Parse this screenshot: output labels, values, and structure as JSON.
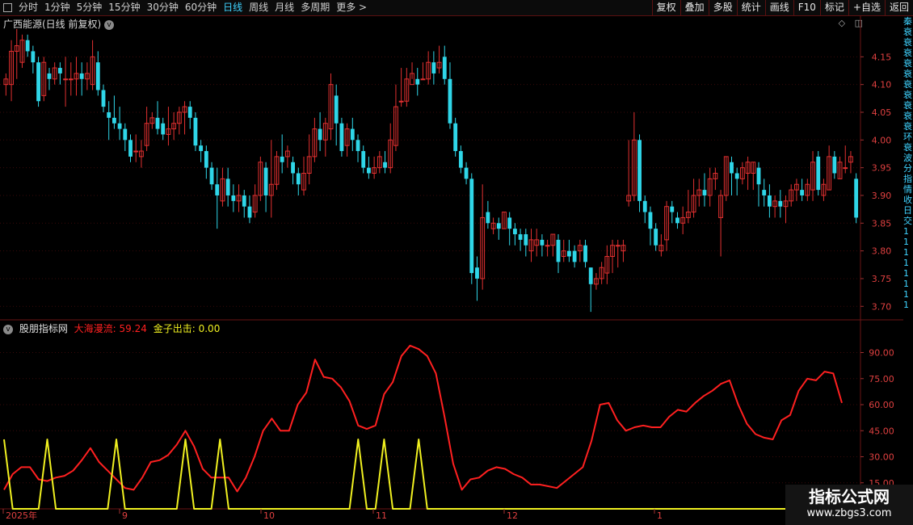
{
  "toolbar": {
    "left": [
      "分时",
      "1分钟",
      "5分钟",
      "15分钟",
      "30分钟",
      "60分钟",
      "日线",
      "周线",
      "月线",
      "多周期",
      "更多 >"
    ],
    "active": "日线",
    "right": [
      "复权",
      "叠加",
      "多股",
      "统计",
      "画线",
      "F10",
      "标记",
      "+自选",
      "返回"
    ]
  },
  "kpane": {
    "title": "广西能源(日线 前复权)",
    "ylabels": [
      "4.15",
      "4.10",
      "4.05",
      "4.00",
      "3.95",
      "3.90",
      "3.85",
      "3.80",
      "3.75",
      "3.70"
    ],
    "colors": {
      "up": "#e23030",
      "down": "#2fd6e8",
      "bg": "#000000",
      "grid": "#3a0a0a"
    }
  },
  "ipane": {
    "name": "股朋指标网",
    "series1_label": "大海漫流:",
    "series1_value": "59.24",
    "series2_label": "金子出击:",
    "series2_value": "0.00",
    "ylabels": [
      "90.00",
      "75.00",
      "60.00",
      "45.00",
      "30.00",
      "15.00"
    ],
    "colors": {
      "line1": "#ff2020",
      "line2": "#f0f020"
    }
  },
  "xaxis": {
    "labels": [
      "2025年",
      "9",
      "10",
      "11",
      "12",
      "1"
    ]
  },
  "watermark": {
    "title": "指标公式网",
    "url": "www.zbgs3.com"
  },
  "right_strip": [
    "秦",
    "衰",
    "衰",
    "衰",
    "衰",
    "衰",
    "衰",
    "衰",
    "衰",
    "衰",
    "衰",
    "环",
    "衰",
    "波",
    "分",
    "指",
    "情",
    "收",
    "",
    "",
    "日",
    "交",
    "1",
    "1",
    "1",
    "1",
    "1",
    "1",
    "1",
    "1"
  ],
  "chart_data": [
    {
      "type": "candlestick",
      "title": "广西能源(日线 前复权)",
      "ylim": [
        3.68,
        4.2
      ],
      "candles": [
        [
          4.1,
          4.11,
          4.08,
          4.12
        ],
        [
          4.1,
          4.16,
          4.07,
          4.18
        ],
        [
          4.16,
          4.17,
          4.11,
          4.2
        ],
        [
          4.14,
          4.18,
          4.13,
          4.19
        ],
        [
          4.18,
          4.16,
          4.15,
          4.19
        ],
        [
          4.16,
          4.14,
          4.12,
          4.17
        ],
        [
          4.14,
          4.07,
          4.06,
          4.15
        ],
        [
          4.08,
          4.14,
          4.07,
          4.15
        ],
        [
          4.12,
          4.11,
          4.09,
          4.13
        ],
        [
          4.11,
          4.13,
          4.1,
          4.14
        ],
        [
          4.13,
          4.12,
          4.1,
          4.14
        ],
        [
          4.11,
          4.11,
          4.06,
          4.15
        ],
        [
          4.11,
          4.11,
          4.08,
          4.14
        ],
        [
          4.11,
          4.12,
          4.08,
          4.15
        ],
        [
          4.12,
          4.11,
          4.08,
          4.14
        ],
        [
          4.11,
          4.12,
          4.09,
          4.14
        ],
        [
          4.1,
          4.15,
          4.09,
          4.18
        ],
        [
          4.14,
          4.09,
          4.08,
          4.16
        ],
        [
          4.09,
          4.06,
          4.05,
          4.1
        ],
        [
          4.05,
          4.04,
          4.0,
          4.07
        ],
        [
          4.04,
          4.03,
          4.02,
          4.08
        ],
        [
          4.03,
          4.02,
          4.0,
          4.06
        ],
        [
          4.02,
          4.0,
          3.98,
          4.03
        ],
        [
          4.0,
          3.97,
          3.96,
          4.01
        ],
        [
          3.98,
          3.98,
          3.96,
          4.01
        ],
        [
          3.97,
          3.98,
          3.95,
          4.0
        ],
        [
          3.99,
          4.03,
          3.98,
          4.06
        ],
        [
          4.03,
          4.04,
          4.02,
          4.05
        ],
        [
          4.04,
          4.02,
          4.01,
          4.07
        ],
        [
          4.03,
          4.01,
          4.0,
          4.04
        ],
        [
          4.01,
          4.02,
          3.99,
          4.06
        ],
        [
          4.02,
          4.03,
          4.0,
          4.05
        ],
        [
          4.03,
          4.05,
          4.01,
          4.06
        ],
        [
          4.05,
          4.06,
          4.01,
          4.07
        ],
        [
          4.06,
          4.04,
          4.02,
          4.07
        ],
        [
          4.04,
          3.99,
          3.98,
          4.05
        ],
        [
          3.99,
          3.98,
          3.96,
          4.0
        ],
        [
          3.98,
          3.95,
          3.93,
          3.99
        ],
        [
          3.95,
          3.92,
          3.91,
          3.96
        ],
        [
          3.92,
          3.9,
          3.84,
          3.95
        ],
        [
          3.89,
          3.93,
          3.88,
          3.95
        ],
        [
          3.93,
          3.9,
          3.88,
          3.95
        ],
        [
          3.9,
          3.89,
          3.87,
          3.92
        ],
        [
          3.89,
          3.9,
          3.87,
          3.92
        ],
        [
          3.9,
          3.88,
          3.86,
          3.91
        ],
        [
          3.88,
          3.86,
          3.85,
          3.9
        ],
        [
          3.87,
          3.9,
          3.86,
          3.92
        ],
        [
          3.9,
          3.96,
          3.89,
          3.97
        ],
        [
          3.95,
          3.9,
          3.87,
          3.96
        ],
        [
          3.9,
          3.92,
          3.86,
          4.0
        ],
        [
          3.92,
          3.97,
          3.91,
          3.98
        ],
        [
          3.97,
          3.96,
          3.94,
          4.01
        ],
        [
          3.97,
          3.98,
          3.95,
          3.99
        ],
        [
          3.96,
          3.94,
          3.92,
          3.97
        ],
        [
          3.94,
          3.92,
          3.9,
          3.95
        ],
        [
          3.91,
          3.94,
          3.9,
          3.97
        ],
        [
          3.94,
          3.97,
          3.92,
          4.01
        ],
        [
          3.97,
          4.02,
          3.96,
          4.04
        ],
        [
          4.02,
          4.0,
          3.98,
          4.05
        ],
        [
          4.0,
          4.03,
          3.97,
          4.04
        ],
        [
          4.02,
          4.1,
          4.0,
          4.12
        ],
        [
          4.08,
          4.03,
          3.99,
          4.1
        ],
        [
          4.03,
          3.98,
          3.97,
          4.04
        ],
        [
          3.99,
          4.02,
          3.97,
          4.03
        ],
        [
          4.02,
          4.0,
          3.98,
          4.04
        ],
        [
          4.0,
          3.98,
          3.96,
          4.01
        ],
        [
          3.98,
          3.95,
          3.94,
          3.99
        ],
        [
          3.95,
          3.94,
          3.93,
          3.97
        ],
        [
          3.94,
          3.95,
          3.93,
          3.97
        ],
        [
          3.95,
          3.97,
          3.94,
          3.98
        ],
        [
          3.96,
          3.95,
          3.94,
          3.98
        ],
        [
          3.95,
          4.0,
          3.94,
          4.03
        ],
        [
          3.99,
          4.06,
          3.98,
          4.1
        ],
        [
          4.07,
          4.07,
          4.06,
          4.13
        ],
        [
          4.07,
          4.11,
          4.06,
          4.13
        ],
        [
          4.1,
          4.12,
          4.11,
          4.14
        ],
        [
          4.11,
          4.1,
          4.08,
          4.13
        ],
        [
          4.11,
          4.11,
          4.11,
          4.14
        ],
        [
          4.11,
          4.14,
          4.1,
          4.16
        ],
        [
          4.14,
          4.12,
          4.1,
          4.16
        ],
        [
          4.13,
          4.14,
          4.12,
          4.17
        ],
        [
          4.15,
          4.11,
          4.1,
          4.17
        ],
        [
          4.11,
          4.03,
          4.02,
          4.14
        ],
        [
          4.03,
          3.98,
          3.97,
          4.04
        ],
        [
          3.98,
          3.95,
          3.94,
          3.99
        ],
        [
          3.95,
          3.93,
          3.92,
          3.96
        ],
        [
          3.93,
          3.76,
          3.74,
          3.94
        ],
        [
          3.77,
          3.75,
          3.71,
          3.79
        ],
        [
          3.75,
          3.86,
          3.73,
          3.92
        ],
        [
          3.87,
          3.85,
          3.84,
          3.89
        ],
        [
          3.84,
          3.85,
          3.83,
          3.86
        ],
        [
          3.85,
          3.84,
          3.82,
          3.86
        ],
        [
          3.84,
          3.87,
          3.84,
          3.87
        ],
        [
          3.86,
          3.84,
          3.81,
          3.87
        ],
        [
          3.84,
          3.83,
          3.81,
          3.85
        ],
        [
          3.83,
          3.82,
          3.8,
          3.84
        ],
        [
          3.83,
          3.81,
          3.79,
          3.84
        ],
        [
          3.8,
          3.82,
          3.78,
          3.84
        ],
        [
          3.81,
          3.82,
          3.79,
          3.84
        ],
        [
          3.82,
          3.81,
          3.79,
          3.83
        ],
        [
          3.81,
          3.81,
          3.79,
          3.82
        ],
        [
          3.81,
          3.83,
          3.79,
          3.83
        ],
        [
          3.82,
          3.78,
          3.76,
          3.83
        ],
        [
          3.79,
          3.8,
          3.78,
          3.82
        ],
        [
          3.8,
          3.79,
          3.78,
          3.82
        ],
        [
          3.8,
          3.78,
          3.77,
          3.81
        ],
        [
          3.8,
          3.81,
          3.78,
          3.82
        ],
        [
          3.81,
          3.78,
          3.77,
          3.82
        ],
        [
          3.77,
          3.74,
          3.69,
          3.77
        ],
        [
          3.74,
          3.75,
          3.73,
          3.76
        ],
        [
          3.75,
          3.77,
          3.74,
          3.78
        ],
        [
          3.76,
          3.79,
          3.74,
          3.81
        ],
        [
          3.79,
          3.81,
          3.76,
          3.82
        ],
        [
          3.81,
          3.81,
          3.77,
          3.82
        ],
        [
          3.8,
          3.81,
          3.78,
          3.82
        ],
        [
          3.89,
          3.9,
          3.88,
          4.0
        ],
        [
          3.9,
          4.0,
          3.89,
          4.05
        ],
        [
          4.0,
          3.89,
          3.87,
          4.01
        ],
        [
          3.89,
          3.87,
          3.85,
          3.9
        ],
        [
          3.87,
          3.84,
          3.81,
          3.88
        ],
        [
          3.84,
          3.81,
          3.8,
          3.85
        ],
        [
          3.8,
          3.81,
          3.79,
          3.83
        ],
        [
          3.82,
          3.88,
          3.8,
          3.89
        ],
        [
          3.88,
          3.87,
          3.85,
          3.89
        ],
        [
          3.86,
          3.85,
          3.84,
          3.87
        ],
        [
          3.85,
          3.86,
          3.83,
          3.88
        ],
        [
          3.86,
          3.87,
          3.85,
          3.91
        ],
        [
          3.87,
          3.9,
          3.86,
          3.93
        ],
        [
          3.9,
          3.91,
          3.88,
          3.93
        ],
        [
          3.91,
          3.9,
          3.88,
          3.94
        ],
        [
          3.9,
          3.93,
          3.88,
          3.95
        ],
        [
          3.93,
          3.94,
          3.91,
          3.95
        ],
        [
          3.86,
          3.9,
          3.79,
          3.91
        ],
        [
          3.9,
          3.97,
          3.89,
          3.97
        ],
        [
          3.96,
          3.94,
          3.9,
          3.97
        ],
        [
          3.94,
          3.93,
          3.9,
          3.95
        ],
        [
          3.93,
          3.95,
          3.92,
          3.96
        ],
        [
          3.94,
          3.96,
          3.91,
          3.97
        ],
        [
          3.94,
          3.96,
          3.91,
          3.96
        ],
        [
          3.95,
          3.92,
          3.88,
          3.96
        ],
        [
          3.91,
          3.9,
          3.88,
          3.93
        ],
        [
          3.9,
          3.88,
          3.86,
          3.92
        ],
        [
          3.88,
          3.89,
          3.86,
          3.9
        ],
        [
          3.89,
          3.88,
          3.86,
          3.91
        ],
        [
          3.88,
          3.89,
          3.85,
          3.9
        ],
        [
          3.89,
          3.91,
          3.88,
          3.92
        ],
        [
          3.91,
          3.92,
          3.89,
          3.93
        ],
        [
          3.91,
          3.9,
          3.89,
          3.93
        ],
        [
          3.9,
          3.92,
          3.89,
          3.93
        ],
        [
          3.91,
          3.96,
          3.89,
          3.98
        ],
        [
          3.97,
          3.91,
          3.9,
          3.98
        ],
        [
          3.9,
          3.92,
          3.89,
          3.93
        ],
        [
          3.91,
          3.97,
          3.91,
          3.99
        ],
        [
          3.97,
          3.94,
          3.93,
          3.98
        ],
        [
          3.93,
          3.96,
          3.93,
          3.97
        ],
        [
          3.95,
          3.95,
          3.94,
          3.99
        ],
        [
          3.96,
          3.97,
          3.94,
          3.98
        ],
        [
          3.93,
          3.86,
          3.85,
          3.94
        ]
      ]
    },
    {
      "type": "line",
      "series": [
        {
          "name": "大海漫流",
          "values": [
            11,
            20,
            24,
            24,
            17,
            16,
            18,
            19,
            22,
            28,
            35,
            27,
            22,
            17,
            12,
            11,
            18,
            27,
            28,
            31,
            37,
            45,
            36,
            23,
            18,
            18,
            18,
            10,
            18,
            30,
            45,
            52,
            45,
            45,
            60,
            67,
            86,
            76,
            75,
            70,
            62,
            48,
            46,
            48,
            66,
            73,
            88,
            94,
            92,
            88,
            78,
            53,
            26,
            11,
            17,
            18,
            22,
            24,
            23,
            20,
            18,
            14,
            14,
            13,
            12,
            16,
            20,
            24,
            39,
            60,
            61,
            51,
            45,
            47,
            48,
            47,
            47,
            53,
            57,
            56,
            61,
            65,
            68,
            72,
            74,
            60,
            49,
            43,
            41,
            40,
            51,
            54,
            68,
            75,
            74,
            79,
            78,
            61
          ]
        },
        {
          "name": "金子出击",
          "values": [
            40,
            0,
            0,
            0,
            0,
            40,
            0,
            0,
            0,
            0,
            0,
            0,
            0,
            40,
            0,
            0,
            0,
            0,
            0,
            0,
            0,
            40,
            0,
            0,
            0,
            40,
            0,
            0,
            0,
            0,
            0,
            0,
            0,
            0,
            0,
            0,
            0,
            0,
            0,
            0,
            0,
            40,
            0,
            0,
            40,
            0,
            0,
            0,
            40,
            0,
            0,
            0,
            0,
            0,
            0,
            0,
            0,
            0,
            0,
            0,
            0,
            0,
            0,
            0,
            0,
            0,
            0,
            0,
            0,
            0,
            0,
            0,
            0,
            0,
            0,
            0,
            0,
            0,
            0,
            0,
            0,
            0,
            0,
            0,
            0,
            0,
            0,
            0,
            0,
            0,
            0,
            0,
            0,
            0,
            0,
            0,
            0,
            0
          ]
        }
      ],
      "ylim": [
        0,
        100
      ]
    }
  ]
}
